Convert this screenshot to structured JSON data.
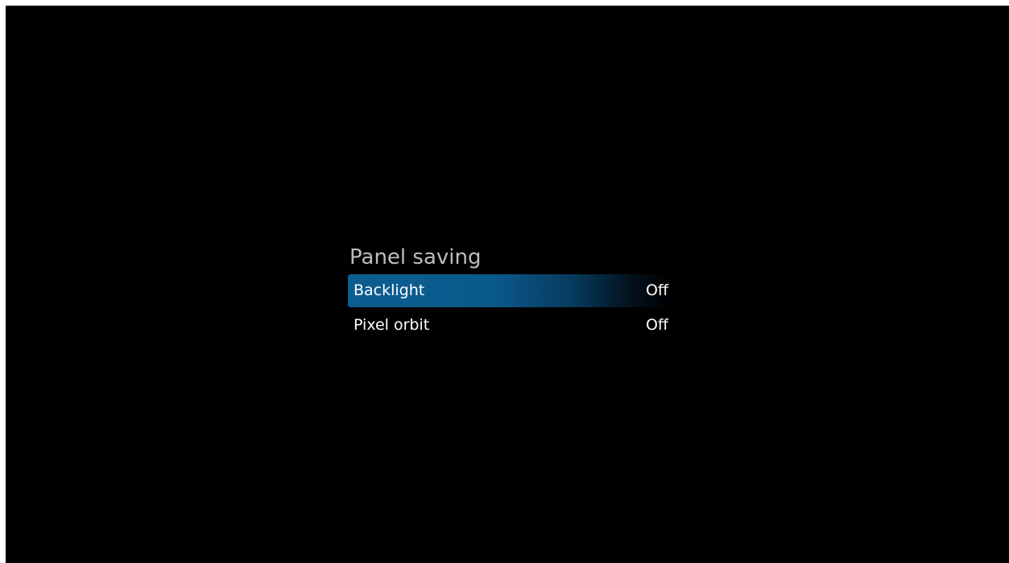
{
  "panel": {
    "title": "Panel saving",
    "items": [
      {
        "label": "Backlight",
        "value": "Off",
        "selected": true
      },
      {
        "label": "Pixel orbit",
        "value": "Off",
        "selected": false
      }
    ]
  },
  "colors": {
    "background": "#000000",
    "title_text": "#bdbdbd",
    "item_text": "#ffffff",
    "selection_highlight": "#0d5d91"
  }
}
